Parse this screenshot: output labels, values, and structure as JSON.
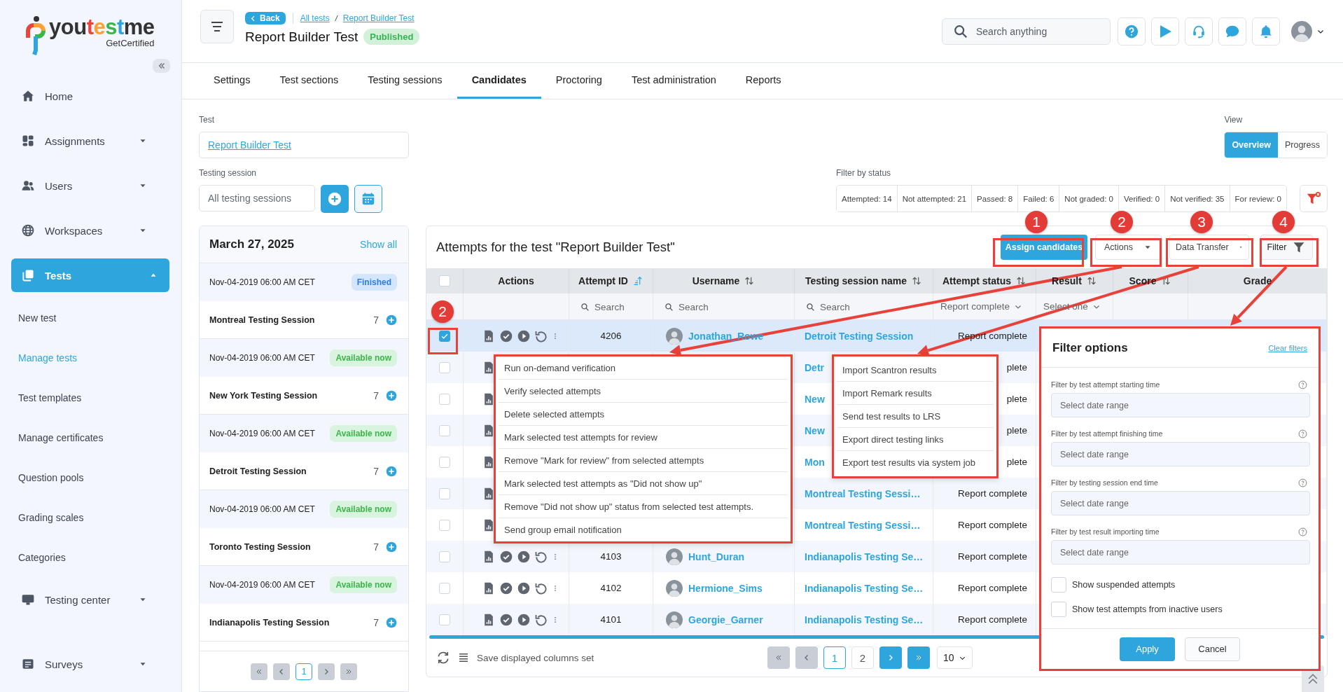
{
  "sidebar": {
    "logo": {
      "parts": [
        {
          "text": "you",
          "color": "#333333"
        },
        {
          "text": "t",
          "color": "#e8463a"
        },
        {
          "text": "e",
          "color": "#f7a234"
        },
        {
          "text": "s",
          "color": "#3cb54a"
        },
        {
          "text": "t",
          "color": "#2ea6dd"
        },
        {
          "text": "me",
          "color": "#333333"
        }
      ],
      "tagline": "GetCertified"
    },
    "items": [
      {
        "label": "Home",
        "kind": "link",
        "selected": false
      },
      {
        "label": "Assignments",
        "kind": "group",
        "expanded": false,
        "selected": false
      },
      {
        "label": "Users",
        "kind": "group",
        "expanded": false,
        "selected": false
      },
      {
        "label": "Workspaces",
        "kind": "group",
        "expanded": false,
        "selected": false
      },
      {
        "label": "Tests",
        "kind": "group",
        "expanded": true,
        "selected": true
      },
      {
        "label": "New test",
        "kind": "sub",
        "selected": false
      },
      {
        "label": "Manage tests",
        "kind": "sub",
        "selected": true
      },
      {
        "label": "Test templates",
        "kind": "sub",
        "selected": false
      },
      {
        "label": "Manage certificates",
        "kind": "sub",
        "selected": false
      },
      {
        "label": "Question pools",
        "kind": "sub",
        "selected": false
      },
      {
        "label": "Grading scales",
        "kind": "sub",
        "selected": false
      },
      {
        "label": "Categories",
        "kind": "sub",
        "selected": false
      },
      {
        "label": "Testing center",
        "kind": "group",
        "expanded": false,
        "selected": false
      },
      {
        "label": "Surveys",
        "kind": "group",
        "expanded": false,
        "selected": false
      }
    ]
  },
  "header": {
    "back": "Back",
    "breadcrumbs": [
      "All tests",
      "Report Builder Test"
    ],
    "separator": "/",
    "title": "Report Builder Test",
    "status": "Published",
    "search": {
      "placeholder": "Search anything"
    }
  },
  "tabs": [
    {
      "label": "Settings",
      "selected": false
    },
    {
      "label": "Test sections",
      "selected": false
    },
    {
      "label": "Testing sessions",
      "selected": false
    },
    {
      "label": "Candidates",
      "selected": true
    },
    {
      "label": "Proctoring",
      "selected": false
    },
    {
      "label": "Test administration",
      "selected": false
    },
    {
      "label": "Reports",
      "selected": false
    }
  ],
  "test_field": {
    "label": "Test",
    "value": "Report Builder Test"
  },
  "session_field": {
    "label": "Testing session",
    "placeholder": "All testing sessions"
  },
  "view": {
    "label": "View",
    "options": [
      {
        "label": "Overview",
        "selected": true
      },
      {
        "label": "Progress",
        "selected": false
      }
    ]
  },
  "status_filter": {
    "label": "Filter by status",
    "items": [
      "Attempted: 14",
      "Not attempted: 21",
      "Passed: 8",
      "Failed: 6",
      "Not graded: 0",
      "Verified: 0",
      "Not verified: 35",
      "For review: 0"
    ]
  },
  "sessions_panel": {
    "date": "March 27, 2025",
    "show_all": "Show all",
    "entries": [
      {
        "time": "Nov-04-2019 06:00 AM CET",
        "status": "Finished",
        "kind": "finished",
        "name": "Montreal Testing Session",
        "count": "7"
      },
      {
        "time": "Nov-04-2019 06:00 AM CET",
        "status": "Available now",
        "kind": "available",
        "name": "New York Testing Session",
        "count": "7"
      },
      {
        "time": "Nov-04-2019 06:00 AM CET",
        "status": "Available now",
        "kind": "available",
        "name": "Detroit Testing Session",
        "count": "7"
      },
      {
        "time": "Nov-04-2019 06:00 AM CET",
        "status": "Available now",
        "kind": "available",
        "name": "Toronto Testing Session",
        "count": "7"
      },
      {
        "time": "Nov-04-2019 06:00 AM CET",
        "status": "Available now",
        "kind": "available",
        "name": "Indianapolis Testing Session",
        "count": "7"
      }
    ],
    "pages": [
      {
        "label": "1",
        "selected": true
      }
    ]
  },
  "table": {
    "title": "Attempts for the test \"Report Builder Test\"",
    "buttons": [
      {
        "label": "Assign candidates",
        "kind": "primary"
      },
      {
        "label": "Actions",
        "kind": "dropdown"
      },
      {
        "label": "Data Transfer",
        "kind": "dropdown"
      },
      {
        "label": "Filter",
        "kind": "filter"
      }
    ],
    "select_all": {
      "checked": false
    },
    "columns": [
      {
        "label": "Actions",
        "sortable": false,
        "sorted": false,
        "filter": {
          "kind": "none"
        }
      },
      {
        "label": "Attempt ID",
        "sortable": true,
        "sorted": true,
        "filter": {
          "kind": "search",
          "placeholder": "Search"
        }
      },
      {
        "label": "Username",
        "sortable": true,
        "sorted": false,
        "filter": {
          "kind": "search",
          "placeholder": "Search"
        }
      },
      {
        "label": "Testing session name",
        "sortable": true,
        "sorted": false,
        "filter": {
          "kind": "search",
          "placeholder": "Search"
        }
      },
      {
        "label": "Attempt status",
        "sortable": true,
        "sorted": false,
        "filter": {
          "kind": "select",
          "value": "Report complete"
        }
      },
      {
        "label": "Result",
        "sortable": true,
        "sorted": false,
        "filter": {
          "kind": "select",
          "value": "Select one"
        }
      },
      {
        "label": "Score",
        "sortable": true,
        "sorted": false,
        "filter": {
          "kind": "none"
        }
      },
      {
        "label": "Grade",
        "sortable": false,
        "sorted": false,
        "filter": {
          "kind": "none"
        }
      }
    ],
    "rows": [
      {
        "kind": "full",
        "selected": true,
        "attempt_id": "4206",
        "username": "Jonathan_Rowe",
        "session": "Detroit Testing Session",
        "status": "Report complete"
      },
      {
        "kind": "partial",
        "selected": false,
        "session": "Detr",
        "status": "plete"
      },
      {
        "kind": "partial",
        "selected": false,
        "session": "New",
        "status": "plete"
      },
      {
        "kind": "partial",
        "selected": false,
        "session": "New",
        "status": "plete"
      },
      {
        "kind": "partial",
        "selected": false,
        "session": "Mon",
        "status": "plete"
      },
      {
        "kind": "partial",
        "selected": false,
        "session": "Montreal Testing Sessi…",
        "status": "Report complete"
      },
      {
        "kind": "partial",
        "selected": false,
        "session": "Montreal Testing Sessi…",
        "status": "Report complete"
      },
      {
        "kind": "full",
        "selected": false,
        "attempt_id": "4103",
        "username": "Hunt_Duran",
        "session": "Indianapolis Testing Se…",
        "status": "Report complete"
      },
      {
        "kind": "full",
        "selected": false,
        "attempt_id": "4102",
        "username": "Hermione_Sims",
        "session": "Indianapolis Testing Se…",
        "status": "Report complete"
      },
      {
        "kind": "full",
        "selected": false,
        "attempt_id": "4101",
        "username": "Georgie_Garner",
        "session": "Indianapolis Testing Se…",
        "status": "Report complete"
      }
    ],
    "footer": {
      "save_columns": "Save displayed columns set",
      "pages": [
        {
          "label": "1",
          "selected": true
        },
        {
          "label": "2",
          "selected": false
        }
      ],
      "page_size": "10"
    }
  },
  "actions_menu": {
    "items": [
      "Run on-demand verification",
      "Verify selected attempts",
      "Delete selected attempts",
      "Mark selected test attempts for review",
      "Remove \"Mark for review\" from selected attempts",
      "Mark selected test attempts as \"Did not show up\"",
      "Remove \"Did not show up\" status from selected test attempts.",
      "Send group email notification"
    ]
  },
  "data_transfer_menu": {
    "items": [
      "Import Scantron results",
      "Import Remark results",
      "Send test results to LRS",
      "Export direct testing links",
      "Export test results via system job"
    ]
  },
  "filter_panel": {
    "title": "Filter options",
    "clear": "Clear filters",
    "filters": [
      {
        "label": "Filter by test attempt starting time",
        "placeholder": "Select date range"
      },
      {
        "label": "Filter by test attempt finishing time",
        "placeholder": "Select date range"
      },
      {
        "label": "Filter by testing session end time",
        "placeholder": "Select date range"
      },
      {
        "label": "Filter by test result importing time",
        "placeholder": "Select date range"
      }
    ],
    "checkboxes": [
      {
        "label": "Show suspended attempts",
        "checked": false
      },
      {
        "label": "Show test attempts from inactive users",
        "checked": false
      }
    ],
    "buttons": [
      {
        "label": "Apply",
        "kind": "primary"
      },
      {
        "label": "Cancel",
        "kind": "secondary"
      }
    ]
  },
  "callouts": [
    {
      "label": "1"
    },
    {
      "label": "2"
    },
    {
      "label": "3"
    },
    {
      "label": "4"
    },
    {
      "label": "2"
    }
  ]
}
